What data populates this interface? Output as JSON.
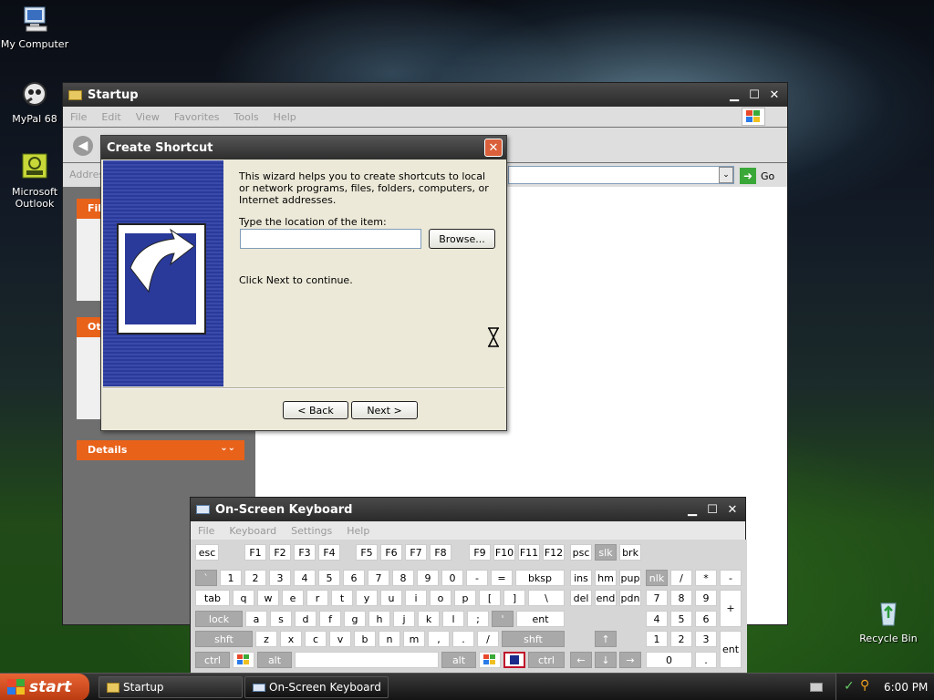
{
  "desktop": {
    "icons": [
      {
        "label": "My Computer"
      },
      {
        "label": "MyPal 68"
      },
      {
        "label": "Microsoft Outlook"
      },
      {
        "label": "Recycle Bin"
      }
    ]
  },
  "explorer": {
    "title": "Startup",
    "menu": [
      "File",
      "Edit",
      "View",
      "Favorites",
      "Tools",
      "Help"
    ],
    "address_label": "Addres",
    "go_label": "Go",
    "panels": [
      {
        "title": "File"
      },
      {
        "title": "Ot"
      },
      {
        "title": "Details"
      }
    ]
  },
  "dialog": {
    "title": "Create Shortcut",
    "intro": "This wizard helps you to create shortcuts to local or network programs, files, folders, computers, or Internet addresses.",
    "location_label": "Type the location of the item:",
    "location_value": "",
    "browse_label": "Browse...",
    "continue_text": "Click Next to continue.",
    "back_label": "< Back",
    "next_label": "Next >"
  },
  "osk": {
    "title": "On-Screen Keyboard",
    "menu": [
      "File",
      "Keyboard",
      "Settings",
      "Help"
    ],
    "rows": {
      "fn": [
        "esc",
        "F1",
        "F2",
        "F3",
        "F4",
        "F5",
        "F6",
        "F7",
        "F8",
        "F9",
        "F10",
        "F11",
        "F12",
        "psc",
        "slk",
        "brk"
      ],
      "num": [
        "`",
        "1",
        "2",
        "3",
        "4",
        "5",
        "6",
        "7",
        "8",
        "9",
        "0",
        "-",
        "=",
        "bksp",
        "ins",
        "hm",
        "pup",
        "nlk",
        "/",
        "*",
        "-"
      ],
      "q": [
        "tab",
        "q",
        "w",
        "e",
        "r",
        "t",
        "y",
        "u",
        "i",
        "o",
        "p",
        "[",
        "]",
        "\\",
        "del",
        "end",
        "pdn",
        "7",
        "8",
        "9",
        "+"
      ],
      "a": [
        "lock",
        "a",
        "s",
        "d",
        "f",
        "g",
        "h",
        "j",
        "k",
        "l",
        ";",
        "'",
        "ent",
        "4",
        "5",
        "6"
      ],
      "z": [
        "shft",
        "z",
        "x",
        "c",
        "v",
        "b",
        "n",
        "m",
        ",",
        ".",
        "/",
        "shft",
        "↑",
        "1",
        "2",
        "3",
        "ent"
      ],
      "bottom": [
        "ctrl",
        "alt",
        "alt",
        "ctrl",
        "←",
        "↓",
        "→",
        "0",
        "."
      ]
    }
  },
  "taskbar": {
    "start_label": "start",
    "tasks": [
      {
        "label": "Startup"
      },
      {
        "label": "On-Screen Keyboard"
      }
    ],
    "clock": "6:00 PM"
  }
}
